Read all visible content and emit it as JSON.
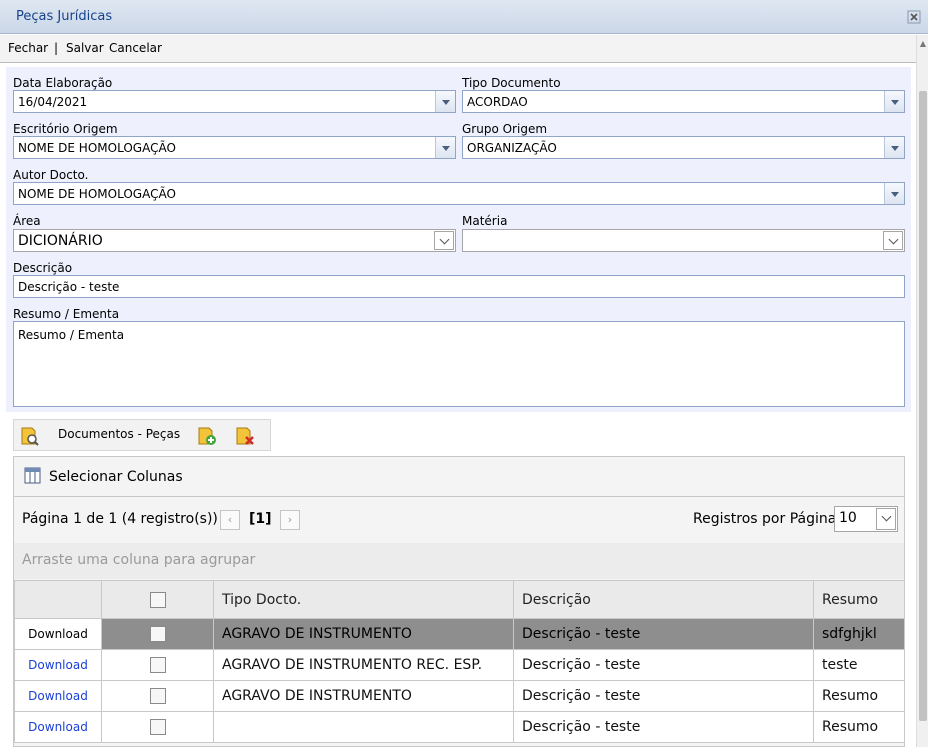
{
  "window": {
    "title": "Peças Jurídicas"
  },
  "toolbar": {
    "close_label": "Fechar",
    "separator": "|",
    "save_label": "Salvar",
    "cancel_label": "Cancelar"
  },
  "form": {
    "data_elaboracao": {
      "label": "Data Elaboração",
      "value": "16/04/2021"
    },
    "tipo_documento": {
      "label": "Tipo Documento",
      "value": "ACORDAO"
    },
    "escritorio_origem": {
      "label": "Escritório Origem",
      "value": "NOME DE HOMOLOGAÇÃO"
    },
    "grupo_origem": {
      "label": "Grupo Origem",
      "value": "ORGANIZAÇÃO"
    },
    "autor_docto": {
      "label": "Autor Docto.",
      "value": "NOME DE HOMOLOGAÇÃO"
    },
    "area": {
      "label": "Área",
      "value": "DICIONÁRIO"
    },
    "materia": {
      "label": "Matéria",
      "value": ""
    },
    "descricao": {
      "label": "Descrição",
      "value": "Descrição - teste"
    },
    "resumo": {
      "label": "Resumo / Ementa",
      "value": "Resumo / Ementa"
    }
  },
  "documents": {
    "label": "Documentos - Peças",
    "select_columns": "Selecionar Colunas",
    "pager": {
      "info": "Página 1 de 1 (4 registro(s))",
      "current": "[1]",
      "per_page_label": "Registros por Página",
      "per_page_value": "10"
    },
    "group_hint": "Arraste uma coluna para agrupar",
    "columns": [
      "Tipo Docto.",
      "Descrição",
      "Resumo"
    ],
    "rows": [
      {
        "link": "Download",
        "tipo": "AGRAVO DE INSTRUMENTO",
        "descricao": "Descrição - teste",
        "resumo": "sdfghjkl",
        "selected": true
      },
      {
        "link": "Download",
        "tipo": "AGRAVO DE INSTRUMENTO REC. ESP.",
        "descricao": "Descrição - teste",
        "resumo": "teste",
        "selected": false
      },
      {
        "link": "Download",
        "tipo": "AGRAVO DE INSTRUMENTO",
        "descricao": "Descrição - teste",
        "resumo": "Resumo",
        "selected": false
      },
      {
        "link": "Download",
        "tipo": "",
        "descricao": "Descrição - teste",
        "resumo": "Resumo",
        "selected": false
      }
    ]
  },
  "icons": {
    "close": "close-icon",
    "search": "document-search-icon",
    "add": "document-add-icon",
    "delete": "document-delete-icon",
    "columns": "columns-icon",
    "prev": "chevron-left-icon",
    "next": "chevron-right-icon"
  },
  "colors": {
    "title_text": "#15428b",
    "form_bg": "#eef0fd",
    "selected_row": "#8e8e8e",
    "link": "#1b3fd6"
  }
}
